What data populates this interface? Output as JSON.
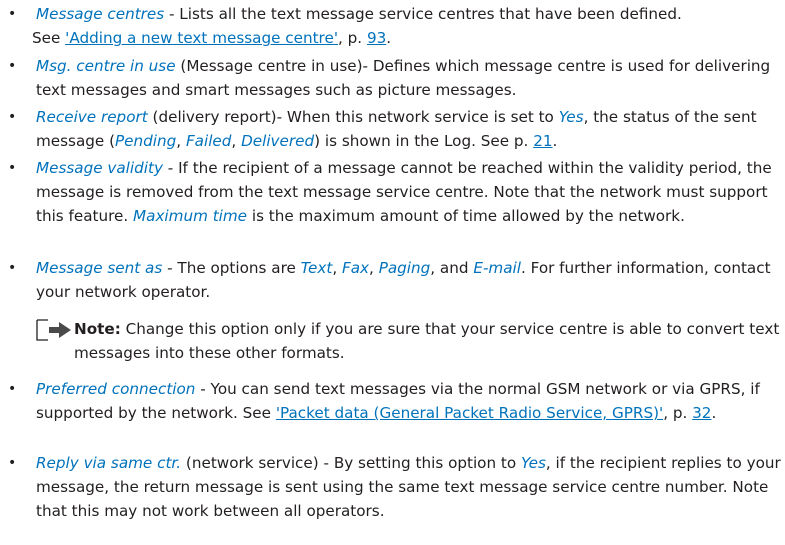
{
  "bullet": "•",
  "items": [
    {
      "term": "Message centres",
      "sep": " - Lists all the text message service centres that have been defined.",
      "see": " See ",
      "link": "'Adding a new text message centre'",
      "page_prefix": ", p. ",
      "page": "93",
      "end": "."
    },
    {
      "term": "Msg. centre in use",
      "rest": " (Message centre in use)- Defines which message centre is used for delivering text messages and smart messages such as picture messages."
    },
    {
      "term": "Receive report",
      "r1": " (delivery report)- When this network service is set to ",
      "yes": "Yes",
      "r2": ", the status of the sent message (",
      "pending": "Pending",
      "c1": ", ",
      "failed": "Failed",
      "c2": ", ",
      "delivered": "Delivered",
      "r3": ") is shown in the Log. See p. ",
      "page": "21",
      "end": "."
    },
    {
      "term": "Message validity",
      "r1": " - If the recipient of a message cannot be reached within the validity period, the message is removed from the text message service centre. Note that the network must support this feature. ",
      "max": "Maximum time",
      "r2": " is the maximum amount of time allowed by the network."
    },
    {
      "term": "Message sent as",
      "r1": " - The options are ",
      "o1": "Text",
      "s1": ", ",
      "o2": "Fax",
      "s2": ", ",
      "o3": "Paging",
      "s3": ", and ",
      "o4": "E-mail",
      "r2": ". For further information, contact your network operator."
    },
    {
      "term": "Preferred connection",
      "r1": " - You can send text messages via the normal GSM network or via GPRS, if supported by the network. See ",
      "link": "'Packet data (General Packet Radio Service, GPRS)'",
      "page_prefix": ", p. ",
      "page": "32",
      "end": "."
    },
    {
      "term": "Reply via same ctr.",
      "r1": " (network service) - By setting this option to ",
      "yes": "Yes",
      "r2": ", if the recipient replies to your message, the return message is sent using the same text message service centre number. Note that this may not work between all operators."
    }
  ],
  "note": {
    "label": "Note:",
    "text": " Change this option only if you are sure that your service centre is able to convert text messages into these other formats."
  },
  "colors": {
    "text": "#231f20",
    "accent": "#0072bc"
  }
}
